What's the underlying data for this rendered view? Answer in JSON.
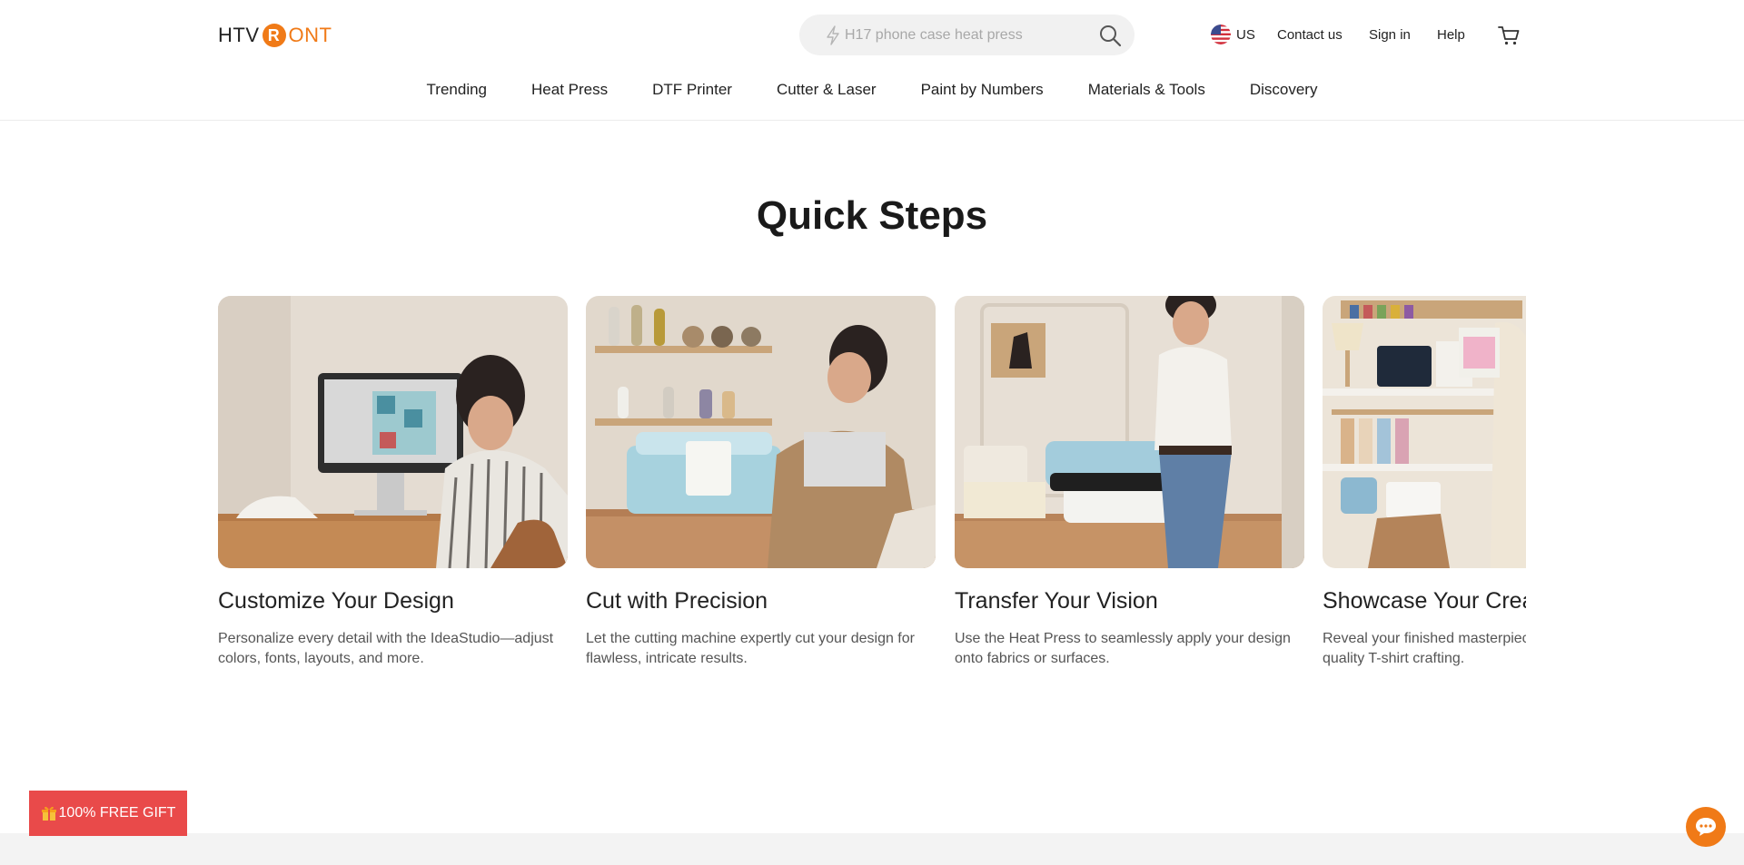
{
  "header": {
    "logo": {
      "left_text": "HTV",
      "mark": "R",
      "right_text": "ONT"
    },
    "search": {
      "placeholder": "H17 phone case heat press",
      "icon": "search-icon",
      "prefix_icon": "bolt-icon"
    },
    "region": {
      "label": "US",
      "icon": "us-flag-icon"
    },
    "contact": "Contact us",
    "signin": "Sign in",
    "help": "Help",
    "cart_icon": "cart-icon"
  },
  "nav": {
    "items": [
      {
        "label": "Trending"
      },
      {
        "label": "Heat Press"
      },
      {
        "label": "DTF Printer"
      },
      {
        "label": "Cutter & Laser"
      },
      {
        "label": "Paint by Numbers"
      },
      {
        "label": "Materials & Tools"
      },
      {
        "label": "Discovery"
      }
    ]
  },
  "main": {
    "title": "Quick Steps",
    "cards": [
      {
        "title": "Customize Your Design",
        "desc": "Personalize every detail with the IdeaStudio—adjust colors, fonts, layouts, and more."
      },
      {
        "title": "Cut with Precision",
        "desc": "Let the cutting machine expertly cut your design for flawless, intricate results."
      },
      {
        "title": "Transfer Your Vision",
        "desc": "Use the Heat Press to seamlessly apply your design onto fabrics or surfaces."
      },
      {
        "title": "Showcase Your Creation",
        "desc": "Reveal your finished masterpiece with professional-quality T-shirt crafting."
      }
    ]
  },
  "floating": {
    "gift_label": "100% FREE GIFT",
    "gift_icon": "gift-icon",
    "chat_icon": "chat-bubble-icon"
  },
  "colors": {
    "accent": "#f07a17",
    "gift_bg": "#e94a4a",
    "search_bg": "#f1f1f1",
    "text": "#222222",
    "muted_text": "#555555"
  }
}
